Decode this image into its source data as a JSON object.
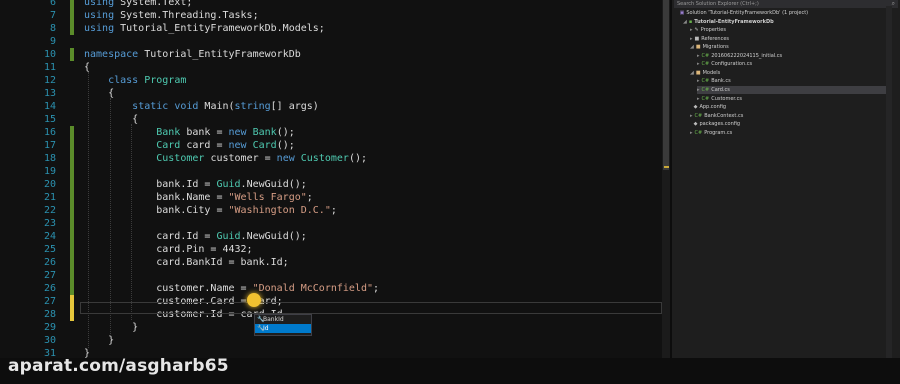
{
  "editor": {
    "lines": [
      {
        "num": "6",
        "mark": "green",
        "tokens": [
          {
            "t": "using ",
            "c": "kw"
          },
          {
            "t": "System.Text;"
          }
        ]
      },
      {
        "num": "7",
        "mark": "green",
        "tokens": [
          {
            "t": "using ",
            "c": "kw"
          },
          {
            "t": "System.Threading.Tasks;"
          }
        ]
      },
      {
        "num": "8",
        "mark": "green",
        "tokens": [
          {
            "t": "using ",
            "c": "kw"
          },
          {
            "t": "Tutorial_EntityFrameworkDb.Models;"
          }
        ]
      },
      {
        "num": "9",
        "mark": "",
        "tokens": []
      },
      {
        "num": "10",
        "mark": "green",
        "tokens": [
          {
            "t": "namespace ",
            "c": "kw"
          },
          {
            "t": "Tutorial_EntityFrameworkDb"
          }
        ]
      },
      {
        "num": "11",
        "mark": "",
        "tokens": [
          {
            "t": "{"
          }
        ]
      },
      {
        "num": "12",
        "mark": "",
        "tokens": [
          {
            "t": "    "
          },
          {
            "t": "class ",
            "c": "kw"
          },
          {
            "t": "Program",
            "c": "ty"
          }
        ]
      },
      {
        "num": "13",
        "mark": "",
        "tokens": [
          {
            "t": "    {"
          }
        ]
      },
      {
        "num": "14",
        "mark": "",
        "tokens": [
          {
            "t": "        "
          },
          {
            "t": "static void ",
            "c": "kw"
          },
          {
            "t": "Main("
          },
          {
            "t": "string",
            "c": "kw"
          },
          {
            "t": "[] args)"
          }
        ]
      },
      {
        "num": "15",
        "mark": "",
        "tokens": [
          {
            "t": "        {"
          }
        ]
      },
      {
        "num": "16",
        "mark": "green",
        "tokens": [
          {
            "t": "            "
          },
          {
            "t": "Bank",
            "c": "ty"
          },
          {
            "t": " bank = "
          },
          {
            "t": "new ",
            "c": "kw"
          },
          {
            "t": "Bank",
            "c": "ty"
          },
          {
            "t": "();"
          }
        ]
      },
      {
        "num": "17",
        "mark": "green",
        "tokens": [
          {
            "t": "            "
          },
          {
            "t": "Card",
            "c": "ty"
          },
          {
            "t": " card = "
          },
          {
            "t": "new ",
            "c": "kw"
          },
          {
            "t": "Card",
            "c": "ty"
          },
          {
            "t": "();"
          }
        ]
      },
      {
        "num": "18",
        "mark": "green",
        "tokens": [
          {
            "t": "            "
          },
          {
            "t": "Customer",
            "c": "ty"
          },
          {
            "t": " customer = "
          },
          {
            "t": "new ",
            "c": "kw"
          },
          {
            "t": "Customer",
            "c": "ty"
          },
          {
            "t": "();"
          }
        ]
      },
      {
        "num": "19",
        "mark": "green",
        "tokens": []
      },
      {
        "num": "20",
        "mark": "green",
        "tokens": [
          {
            "t": "            bank.Id = "
          },
          {
            "t": "Guid",
            "c": "ty"
          },
          {
            "t": ".NewGuid();"
          }
        ]
      },
      {
        "num": "21",
        "mark": "green",
        "tokens": [
          {
            "t": "            bank.Name = "
          },
          {
            "t": "\"Wells Fargo\"",
            "c": "str"
          },
          {
            "t": ";"
          }
        ]
      },
      {
        "num": "22",
        "mark": "green",
        "tokens": [
          {
            "t": "            bank.City = "
          },
          {
            "t": "\"Washington D.C.\"",
            "c": "str"
          },
          {
            "t": ";"
          }
        ]
      },
      {
        "num": "23",
        "mark": "green",
        "tokens": []
      },
      {
        "num": "24",
        "mark": "green",
        "tokens": [
          {
            "t": "            card.Id = "
          },
          {
            "t": "Guid",
            "c": "ty"
          },
          {
            "t": ".NewGuid();"
          }
        ]
      },
      {
        "num": "25",
        "mark": "green",
        "tokens": [
          {
            "t": "            card.Pin = 4432;"
          }
        ]
      },
      {
        "num": "26",
        "mark": "green",
        "tokens": [
          {
            "t": "            card.BankId = bank.Id;"
          }
        ]
      },
      {
        "num": "27",
        "mark": "green",
        "tokens": []
      },
      {
        "num": "26",
        "mark": "green",
        "tokens": [
          {
            "t": "            customer.Name = "
          },
          {
            "t": "\"Donald McCornfield\"",
            "c": "str"
          },
          {
            "t": ";"
          }
        ]
      },
      {
        "num": "27",
        "mark": "yellow",
        "tokens": [
          {
            "t": "            customer.Card = card;"
          }
        ]
      },
      {
        "num": "28",
        "mark": "yellow",
        "tokens": [
          {
            "t": "            customer.Id = card."
          },
          {
            "t": "Id"
          }
        ]
      },
      {
        "num": "29",
        "mark": "",
        "tokens": [
          {
            "t": "        }"
          }
        ]
      },
      {
        "num": "30",
        "mark": "",
        "tokens": [
          {
            "t": "    }"
          }
        ]
      },
      {
        "num": "31",
        "mark": "",
        "tokens": [
          {
            "t": "}"
          }
        ]
      },
      {
        "num": "32",
        "mark": "",
        "tokens": []
      }
    ]
  },
  "intellisense": {
    "items": [
      {
        "label": "BankId",
        "selected": false
      },
      {
        "label": "Id",
        "selected": true
      }
    ]
  },
  "solution_explorer": {
    "search_placeholder": "Search Solution Explorer (Ctrl+;)",
    "items": [
      {
        "label": "Solution 'Tutorial-EntityFrameworkDb' (1 project)",
        "indent": 0,
        "twisty": "",
        "icon": "solution-icon",
        "glyph": "▣",
        "color": "#9b7fd1",
        "bold": false
      },
      {
        "label": "Tutorial-EntityFrameworkDb",
        "indent": 1,
        "twisty": "◢",
        "icon": "project-icon",
        "glyph": "▪",
        "color": "#68b04c",
        "bold": true
      },
      {
        "label": "Properties",
        "indent": 2,
        "twisty": "▸",
        "icon": "wrench-icon",
        "glyph": "✎",
        "color": "#bbbbbb",
        "bold": false
      },
      {
        "label": "References",
        "indent": 2,
        "twisty": "▸",
        "icon": "references-icon",
        "glyph": "■",
        "color": "#bbbbbb",
        "bold": false
      },
      {
        "label": "Migrations",
        "indent": 2,
        "twisty": "◢",
        "icon": "folder-icon",
        "glyph": "■",
        "color": "#dcb67a",
        "bold": false
      },
      {
        "label": "201606222024115_initial.cs",
        "indent": 3,
        "twisty": "▸",
        "icon": "cs-file-icon",
        "glyph": "C#",
        "color": "#68b04c",
        "bold": false
      },
      {
        "label": "Configuration.cs",
        "indent": 3,
        "twisty": "▸",
        "icon": "cs-file-icon",
        "glyph": "C#",
        "color": "#68b04c",
        "bold": false
      },
      {
        "label": "Models",
        "indent": 2,
        "twisty": "◢",
        "icon": "folder-icon",
        "glyph": "■",
        "color": "#dcb67a",
        "bold": false
      },
      {
        "label": "Bank.cs",
        "indent": 3,
        "twisty": "▸",
        "icon": "cs-file-icon",
        "glyph": "C#",
        "color": "#68b04c",
        "bold": false
      },
      {
        "label": "Card.cs",
        "indent": 3,
        "twisty": "▸",
        "icon": "cs-file-icon",
        "glyph": "C#",
        "color": "#68b04c",
        "bold": false
      },
      {
        "label": "Customer.cs",
        "indent": 3,
        "twisty": "▸",
        "icon": "cs-file-icon",
        "glyph": "C#",
        "color": "#68b04c",
        "bold": false
      },
      {
        "label": "App.config",
        "indent": 2,
        "twisty": "",
        "icon": "config-file-icon",
        "glyph": "◆",
        "color": "#bbbbbb",
        "bold": false
      },
      {
        "label": "BankContext.cs",
        "indent": 2,
        "twisty": "▸",
        "icon": "cs-file-icon",
        "glyph": "C#",
        "color": "#68b04c",
        "bold": false
      },
      {
        "label": "packages.config",
        "indent": 2,
        "twisty": "",
        "icon": "config-file-icon",
        "glyph": "◆",
        "color": "#bbbbbb",
        "bold": false
      },
      {
        "label": "Program.cs",
        "indent": 2,
        "twisty": "▸",
        "icon": "cs-file-icon",
        "glyph": "C#",
        "color": "#68b04c",
        "bold": false
      }
    ],
    "selected_label": "Card.cs"
  },
  "watermark": "aparat.com/asgharb65"
}
